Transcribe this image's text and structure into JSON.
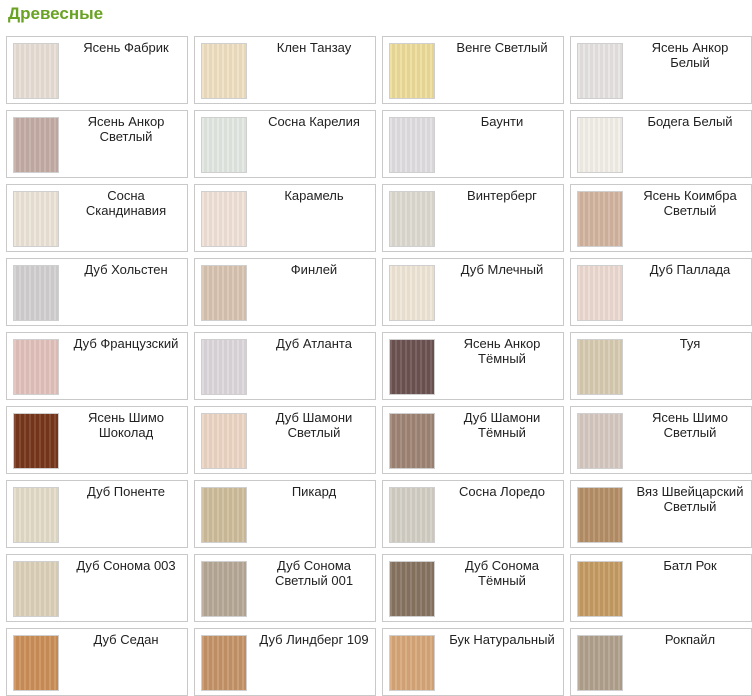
{
  "title": "Древесные",
  "colors": {
    "title": "#6aa223",
    "border": "#c9c9c9"
  },
  "items": [
    {
      "label": "Ясень Фабрик",
      "swatch": "#e8dfd6"
    },
    {
      "label": "Клен Танзау",
      "swatch": "#efe0c2"
    },
    {
      "label": "Венге Светлый",
      "swatch": "#eddc9a"
    },
    {
      "label": "Ясень Анкор Белый",
      "swatch": "#e7e3e3"
    },
    {
      "label": "Ясень Анкор Светлый",
      "swatch": "#c4ada5"
    },
    {
      "label": "Сосна Карелия",
      "swatch": "#e3e8e3"
    },
    {
      "label": "Баунти",
      "swatch": "#e2dfe3"
    },
    {
      "label": "Бодега Белый",
      "swatch": "#f3efe9"
    },
    {
      "label": "Сосна Скандинавия",
      "swatch": "#ece4d8"
    },
    {
      "label": "Карамель",
      "swatch": "#f0e2d7"
    },
    {
      "label": "Винтерберг",
      "swatch": "#dedad1"
    },
    {
      "label": "Ясень Коимбра Светлый",
      "swatch": "#d3b5a0"
    },
    {
      "label": "Дуб Хольстен",
      "swatch": "#d2d0d0"
    },
    {
      "label": "Финлей",
      "swatch": "#d9c4b1"
    },
    {
      "label": "Дуб Млечный",
      "swatch": "#efe6d7"
    },
    {
      "label": "Дуб Паллада",
      "swatch": "#ecdad2"
    },
    {
      "label": "Дуб Французский",
      "swatch": "#e2c2bb"
    },
    {
      "label": "Дуб Атланта",
      "swatch": "#ddd7db"
    },
    {
      "label": "Ясень Анкор Тёмный",
      "swatch": "#6c5351"
    },
    {
      "label": "Туя",
      "swatch": "#d7cbb1"
    },
    {
      "label": "Ясень Шимо Шоколад",
      "swatch": "#77371c"
    },
    {
      "label": "Дуб Шамони Светлый",
      "swatch": "#ecd5c4"
    },
    {
      "label": "Дуб Шамони Тёмный",
      "swatch": "#9e8474"
    },
    {
      "label": "Ясень Шимо Светлый",
      "swatch": "#d5c9c2"
    },
    {
      "label": "Дуб Поненте",
      "swatch": "#e4dcc9"
    },
    {
      "label": "Пикард",
      "swatch": "#cebd9b"
    },
    {
      "label": "Сосна Лоредо",
      "swatch": "#d3cfc5"
    },
    {
      "label": "Вяз Швейцарский Светлый",
      "swatch": "#b58f67"
    },
    {
      "label": "Дуб Сонома 003",
      "swatch": "#ddd1b9"
    },
    {
      "label": "Дуб Сонома Светлый 001",
      "swatch": "#b7a896"
    },
    {
      "label": "Дуб Сонома Тёмный",
      "swatch": "#877461"
    },
    {
      "label": "Батл Рок",
      "swatch": "#c59b62"
    },
    {
      "label": "Дуб Седан",
      "swatch": "#cc8f58"
    },
    {
      "label": "Дуб Линдберг 109",
      "swatch": "#c59468"
    },
    {
      "label": "Бук Натуральный",
      "swatch": "#d6a778"
    },
    {
      "label": "Рокпайл",
      "swatch": "#b1a18d"
    }
  ]
}
